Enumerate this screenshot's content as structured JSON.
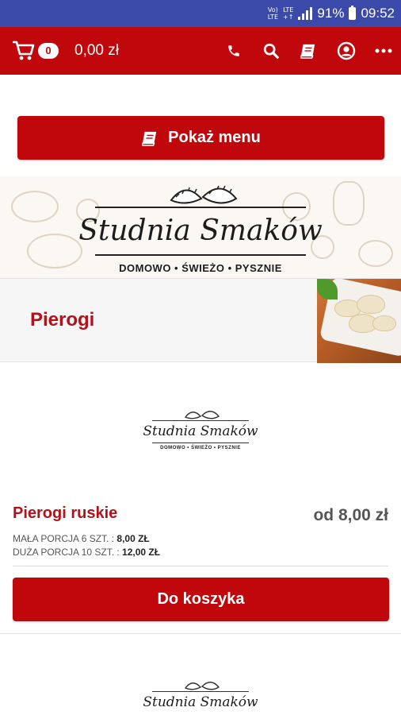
{
  "status_bar": {
    "volte_top": "Vo)",
    "volte_bottom": "LTE",
    "lte_top": "LTE",
    "lte_bottom": "+↑",
    "battery": "91%",
    "time": "09:52"
  },
  "toolbar": {
    "cart_count": "0",
    "cart_total": "0,00 zł",
    "icons": [
      "phone-icon",
      "search-icon",
      "menu-book-icon",
      "account-icon",
      "more-icon"
    ]
  },
  "menu_button": {
    "label": "Pokaż menu"
  },
  "brand": {
    "name": "Studnia Smaków",
    "tagline": "DOMOWO • ŚWIEŻO • PYSZNIE"
  },
  "category": {
    "title": "Pierogi"
  },
  "product": {
    "name": "Pierogi ruskie",
    "price": "od 8,00 zł",
    "options": [
      {
        "label": "MAŁA PORCJA 6 SZT. :",
        "price": "8,00 ZŁ"
      },
      {
        "label": "DUŻA PORCJA 10 SZT. :",
        "price": "12,00 ZŁ"
      }
    ],
    "add_label": "Do koszyka"
  },
  "colors": {
    "brand_red": "#c0080c",
    "title_red": "#b3121a",
    "status_bar": "#3b4aa8"
  }
}
